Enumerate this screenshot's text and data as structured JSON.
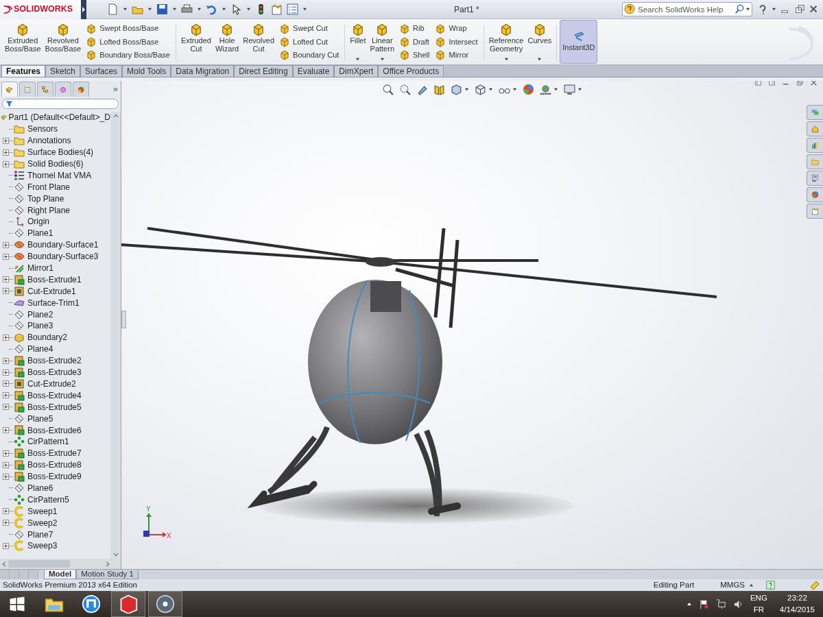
{
  "title_bar": {
    "logo": "SOLIDWORKS",
    "document": "Part1 *"
  },
  "search": {
    "placeholder": "Search SolidWorks Help"
  },
  "ribbon": [
    {
      "kind": "large",
      "label": "Extruded\nBoss/Base",
      "dropdown": false
    },
    {
      "kind": "large",
      "label": "Revolved\nBoss/Base",
      "dropdown": false
    },
    {
      "kind": "stack",
      "items": [
        "Swept Boss/Base",
        "Lofted Boss/Base",
        "Boundary Boss/Base"
      ]
    },
    {
      "kind": "separator"
    },
    {
      "kind": "large",
      "label": "Extruded\nCut",
      "dropdown": false
    },
    {
      "kind": "large",
      "label": "Hole\nWizard",
      "dropdown": false
    },
    {
      "kind": "large",
      "label": "Revolved\nCut",
      "dropdown": false
    },
    {
      "kind": "stack",
      "items": [
        "Swept Cut",
        "Lofted Cut",
        "Boundary Cut"
      ]
    },
    {
      "kind": "separator"
    },
    {
      "kind": "large",
      "label": "Fillet",
      "dropdown": true
    },
    {
      "kind": "large",
      "label": "Linear\nPattern",
      "dropdown": true
    },
    {
      "kind": "stack",
      "items": [
        "Rib",
        "Draft",
        "Shell"
      ]
    },
    {
      "kind": "stack",
      "items": [
        "Wrap",
        "Intersect",
        "Mirror"
      ]
    },
    {
      "kind": "separator"
    },
    {
      "kind": "large",
      "label": "Reference\nGeometry",
      "dropdown": true
    },
    {
      "kind": "large",
      "label": "Curves",
      "dropdown": true
    },
    {
      "kind": "separator"
    }
  ],
  "instant3d": {
    "label": "Instant3D",
    "on": true
  },
  "tabs": [
    {
      "label": "Features",
      "selected": true
    },
    {
      "label": "Sketch",
      "selected": false
    },
    {
      "label": "Surfaces",
      "selected": false
    },
    {
      "label": "Mold Tools",
      "selected": false
    },
    {
      "label": "Data Migration",
      "selected": false
    },
    {
      "label": "Direct Editing",
      "selected": false
    },
    {
      "label": "Evaluate",
      "selected": false
    },
    {
      "label": "DimXpert",
      "selected": false
    },
    {
      "label": "Office Products",
      "selected": false
    }
  ],
  "panel_tabs": [
    {
      "selected": true
    },
    {
      "selected": false
    },
    {
      "selected": false
    },
    {
      "selected": false
    },
    {
      "selected": false
    }
  ],
  "panel_more": "»",
  "tree": {
    "label": "Part1  (Default<<Default>_D",
    "kind": "part",
    "children": [
      {
        "label": "Sensors",
        "kind": "folder",
        "expandable": false
      },
      {
        "label": "Annotations",
        "kind": "folder",
        "expandable": true
      },
      {
        "label": "Surface Bodies(4)",
        "kind": "folder",
        "expandable": true
      },
      {
        "label": "Solid Bodies(6)",
        "kind": "folder",
        "expandable": true
      },
      {
        "label": "Thornel Mat VMA",
        "kind": "material",
        "expandable": false
      },
      {
        "label": "Front Plane",
        "kind": "plane",
        "expandable": false
      },
      {
        "label": "Top Plane",
        "kind": "plane",
        "expandable": false
      },
      {
        "label": "Right Plane",
        "kind": "plane",
        "expandable": false
      },
      {
        "label": "Origin",
        "kind": "origin",
        "expandable": false
      },
      {
        "label": "Plane1",
        "kind": "plane",
        "expandable": false
      },
      {
        "label": "Boundary-Surface1",
        "kind": "surface",
        "expandable": true
      },
      {
        "label": "Boundary-Surface3",
        "kind": "surface",
        "expandable": true
      },
      {
        "label": "Mirror1",
        "kind": "mirror",
        "expandable": false
      },
      {
        "label": "Boss-Extrude1",
        "kind": "extrude",
        "expandable": true
      },
      {
        "label": "Cut-Extrude1",
        "kind": "cut",
        "expandable": true
      },
      {
        "label": "Surface-Trim1",
        "kind": "trim",
        "expandable": false
      },
      {
        "label": "Plane2",
        "kind": "plane",
        "expandable": false
      },
      {
        "label": "Plane3",
        "kind": "plane",
        "expandable": false
      },
      {
        "label": "Boundary2",
        "kind": "boundary",
        "expandable": true
      },
      {
        "label": "Plane4",
        "kind": "plane",
        "expandable": false
      },
      {
        "label": "Boss-Extrude2",
        "kind": "extrude",
        "expandable": true
      },
      {
        "label": "Boss-Extrude3",
        "kind": "extrude",
        "expandable": true
      },
      {
        "label": "Cut-Extrude2",
        "kind": "cut",
        "expandable": true
      },
      {
        "label": "Boss-Extrude4",
        "kind": "extrude",
        "expandable": true
      },
      {
        "label": "Boss-Extrude5",
        "kind": "extrude",
        "expandable": true
      },
      {
        "label": "Plane5",
        "kind": "plane",
        "expandable": false
      },
      {
        "label": "Boss-Extrude6",
        "kind": "extrude",
        "expandable": true
      },
      {
        "label": "CirPattern1",
        "kind": "pattern",
        "expandable": false
      },
      {
        "label": "Boss-Extrude7",
        "kind": "extrude",
        "expandable": true
      },
      {
        "label": "Boss-Extrude8",
        "kind": "extrude",
        "expandable": true
      },
      {
        "label": "Boss-Extrude9",
        "kind": "extrude",
        "expandable": true
      },
      {
        "label": "Plane6",
        "kind": "plane",
        "expandable": false
      },
      {
        "label": "CirPattern5",
        "kind": "pattern",
        "expandable": false
      },
      {
        "label": "Sweep1",
        "kind": "sweep",
        "expandable": true
      },
      {
        "label": "Sweep2",
        "kind": "sweep",
        "expandable": true
      },
      {
        "label": "Plane7",
        "kind": "plane",
        "expandable": false
      },
      {
        "label": "Sweep3",
        "kind": "sweep",
        "expandable": true
      }
    ]
  },
  "viewport": {
    "triad": {
      "y_label": "Y",
      "x_label": "X"
    }
  },
  "bottom_tabs": [
    {
      "label": "Model",
      "selected": true
    },
    {
      "label": "Motion Study 1",
      "selected": false
    }
  ],
  "status_bar": {
    "edition": "SolidWorks Premium 2013 x64 Edition",
    "mode": "Editing Part",
    "units": "MMGS"
  },
  "taskbar": {
    "apps": [
      {
        "running": false
      },
      {
        "running": false
      },
      {
        "running": true
      },
      {
        "running": true
      }
    ],
    "language": "ENG",
    "keyboard": "FR",
    "time": "23:22",
    "date": "4/14/2015"
  }
}
